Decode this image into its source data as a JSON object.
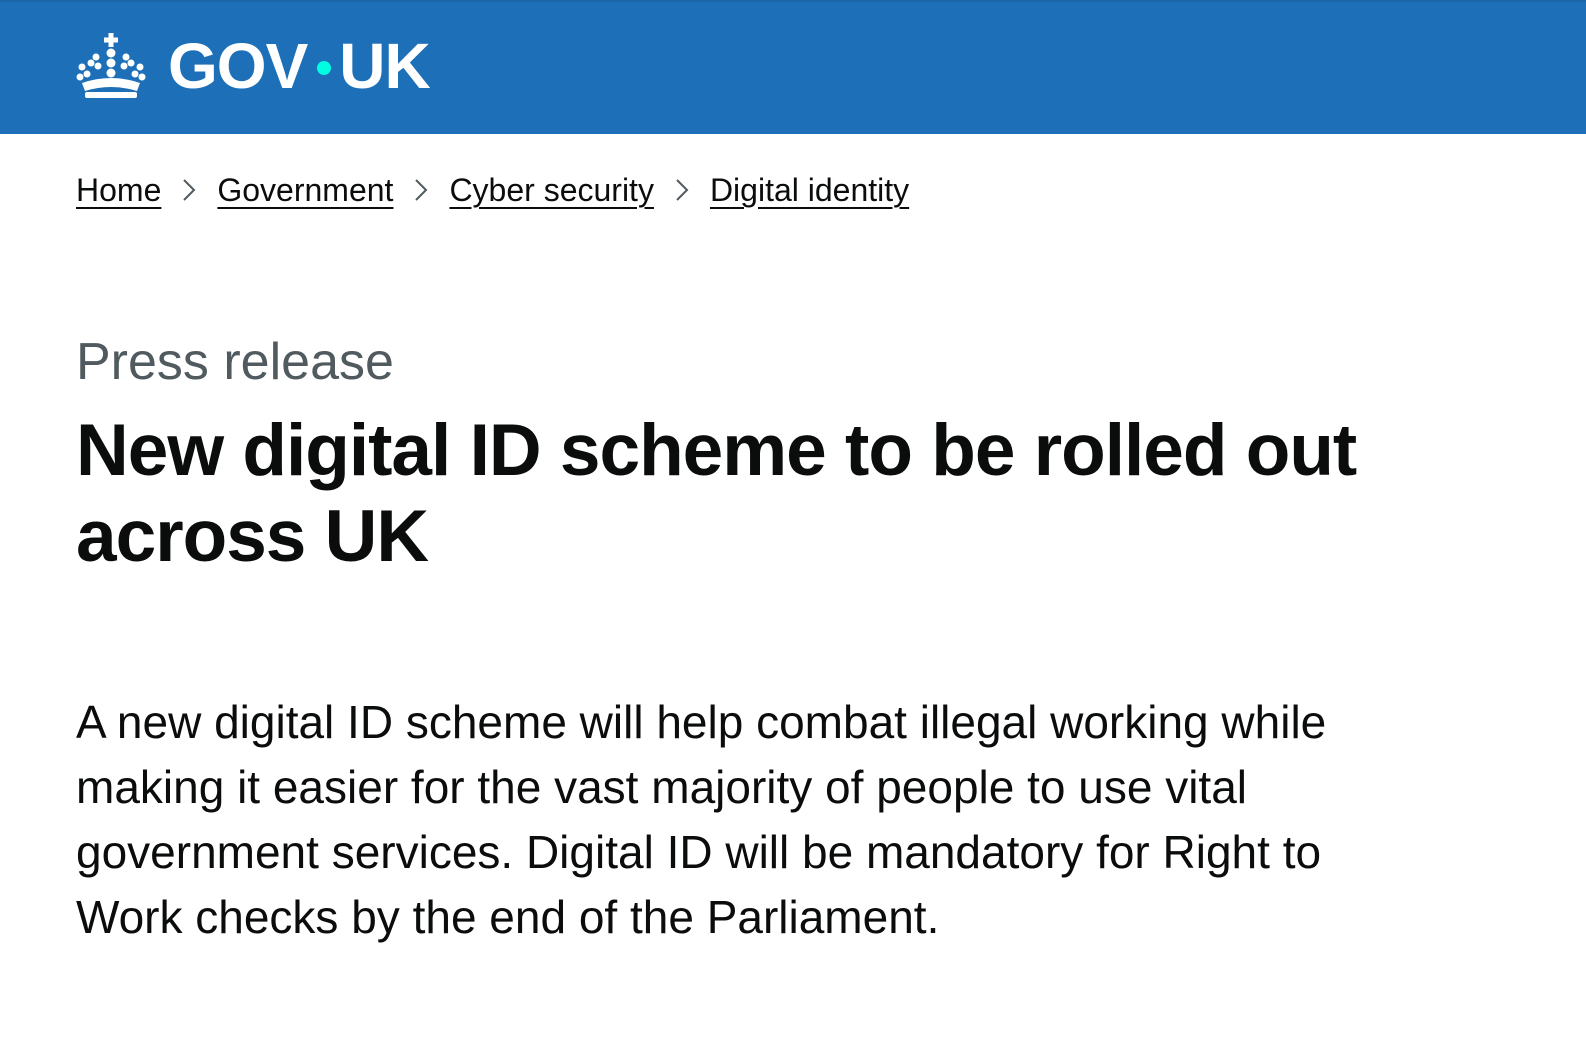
{
  "header": {
    "logo_text_left": "GOV",
    "logo_text_right": "UK",
    "background_color": "#1d70b8",
    "dot_color": "#00ffe0",
    "logo_icon": "crown-icon"
  },
  "breadcrumbs": [
    {
      "label": "Home"
    },
    {
      "label": "Government"
    },
    {
      "label": "Cyber security"
    },
    {
      "label": "Digital identity"
    }
  ],
  "breadcrumb_separator_icon": "chevron-right-icon",
  "article": {
    "caption": "Press release",
    "title": "New digital ID scheme to be rolled out across UK",
    "lede": "A new digital ID scheme will help combat illegal working while making it easier for the vast majority of people to use vital government services. Digital ID will be mandatory for Right to Work checks by the end of the Parliament."
  }
}
